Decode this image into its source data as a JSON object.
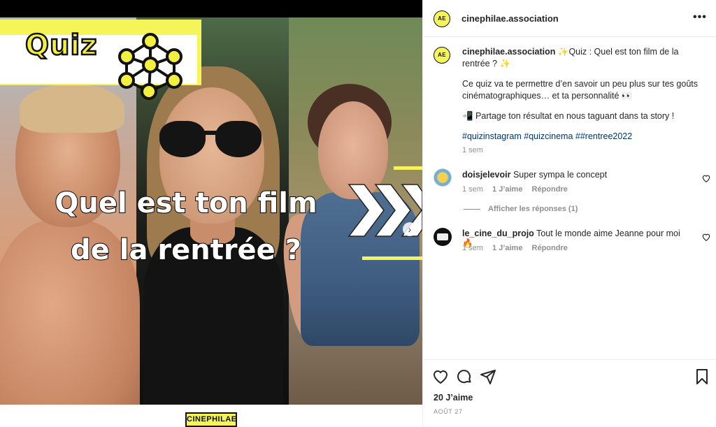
{
  "media": {
    "badge_text": "Quiz",
    "headline_line1": "Quel est ton film",
    "headline_line2": "de la rentrée ?",
    "footer_logo": "CINEPHILAE",
    "accent_color": "#f5f55a"
  },
  "post": {
    "username": "cinephilae.association",
    "avatar_text": "AE",
    "caption": {
      "username": "cinephilae.association",
      "line1": "✨Quiz : Quel est ton film de la rentrée ? ✨",
      "line2": "Ce quiz va te permettre d’en savoir un peu plus sur tes goûts cinématographiques… et ta personnalité 👀",
      "line3": "📲 Partage ton résultat en nous taguant dans ta story !",
      "hashtags": "#quizinstagram #quizcinema ##rentree2022",
      "time": "1 sem"
    },
    "comments": [
      {
        "username": "doisjelevoir",
        "text": "Super sympa le concept",
        "time": "1 sem",
        "likes": "1 J’aime",
        "reply": "Répondre",
        "view_replies": "Afficher les réponses (1)"
      },
      {
        "username": "le_cine_du_projo",
        "text": "Tout le monde aime Jeanne pour moi 🔥",
        "time": "1 sem",
        "likes": "1 J’aime",
        "reply": "Répondre"
      }
    ],
    "likes_count": "20 J’aime",
    "date": "AOÛT 27"
  }
}
